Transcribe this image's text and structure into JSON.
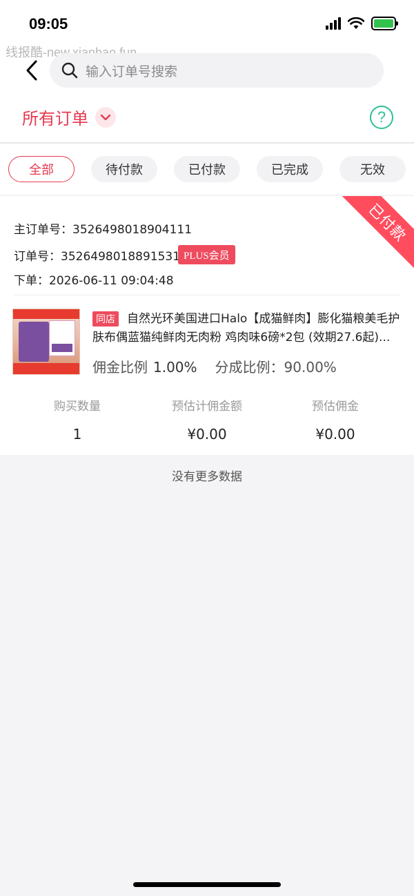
{
  "status_bar": {
    "time": "09:05"
  },
  "watermark": "线报酷-new.xianbao.fun",
  "search": {
    "placeholder": "输入订单号搜索"
  },
  "header": {
    "title": "所有订单",
    "help_icon": "question-circle-icon"
  },
  "tabs": [
    {
      "label": "全部",
      "active": true
    },
    {
      "label": "待付款",
      "active": false
    },
    {
      "label": "已付款",
      "active": false
    },
    {
      "label": "已完成",
      "active": false
    },
    {
      "label": "无效",
      "active": false
    }
  ],
  "order": {
    "status_ribbon": "已付款",
    "main_order_label": "主订单号：",
    "main_order_no": "3526498018904111",
    "order_label": "订单号：",
    "order_no": "3526498018891531",
    "member_badge": "PLUS会员",
    "time_label": "下单：",
    "order_time": "2026-06-11 09:04:48",
    "product": {
      "shop_tag": "同店",
      "title": "自然光环美国进口Halo【成猫鲜肉】膨化猫粮美毛护肤布偶蓝猫纯鲜肉无肉粉 鸡肉味6磅*2包 (效期27.6起)...",
      "commission_label": "佣金比例",
      "commission_rate": "1.00%",
      "share_label": "分成比例：",
      "share_rate": "90.00%"
    },
    "stats": [
      {
        "label": "购买数量",
        "value": "1"
      },
      {
        "label": "预估计佣金额",
        "value": "¥0.00"
      },
      {
        "label": "预估佣金",
        "value": "¥0.00"
      }
    ]
  },
  "footer": {
    "no_more": "没有更多数据"
  },
  "colors": {
    "accent": "#e6394f",
    "help": "#2bbf98",
    "ribbon": "#ff4d5e",
    "battery": "#33c24d"
  }
}
